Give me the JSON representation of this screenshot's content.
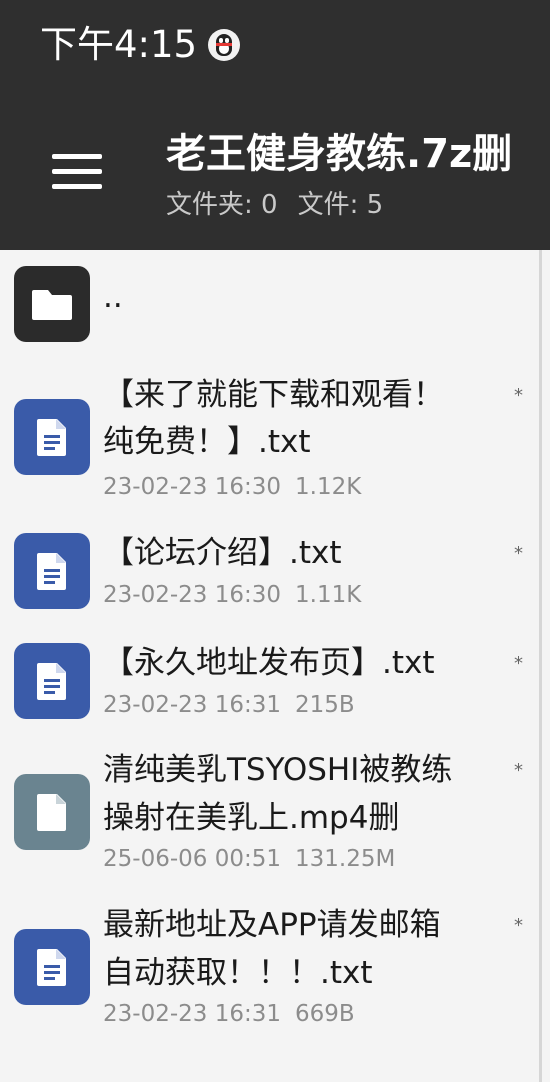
{
  "status_bar": {
    "time": "下午4:15",
    "notification_icon": "qq-penguin-icon"
  },
  "app_bar": {
    "menu_icon": "hamburger-menu-icon",
    "title": "老王健身教练.7z删",
    "folder_count_label": "文件夹: 0",
    "file_count_label": "文件: 5"
  },
  "list": {
    "parent": {
      "name": "..",
      "icon": "folder-icon"
    },
    "items": [
      {
        "name_line1": "【来了就能下载和观看！",
        "name_line2": "纯免费！】.txt",
        "date": "23-02-23 16:30",
        "size": "1.12K",
        "mark": "*",
        "icon": "text-file-icon"
      },
      {
        "name_line1": "【论坛介绍】.txt",
        "date": "23-02-23 16:30",
        "size": "1.11K",
        "mark": "*",
        "icon": "text-file-icon"
      },
      {
        "name_line1": "【永久地址发布页】.txt",
        "date": "23-02-23 16:31",
        "size": "215B",
        "mark": "*",
        "icon": "text-file-icon"
      },
      {
        "name_line1": "清纯美乳TSYOSHI被教练",
        "name_line2": "操射在美乳上.mp4删",
        "date": "25-06-06 00:51",
        "size": "131.25M",
        "mark": "*",
        "icon": "generic-file-icon"
      },
      {
        "name_line1": "最新地址及APP请发邮箱",
        "name_line2": "自动获取！！！.txt",
        "date": "23-02-23 16:31",
        "size": "669B",
        "mark": "*",
        "icon": "text-file-icon"
      }
    ]
  },
  "colors": {
    "app_bar": "#2f2f2f",
    "doc_icon": "#3a5ba9",
    "file_icon": "#6a8490",
    "folder_icon": "#2b2b2b"
  }
}
